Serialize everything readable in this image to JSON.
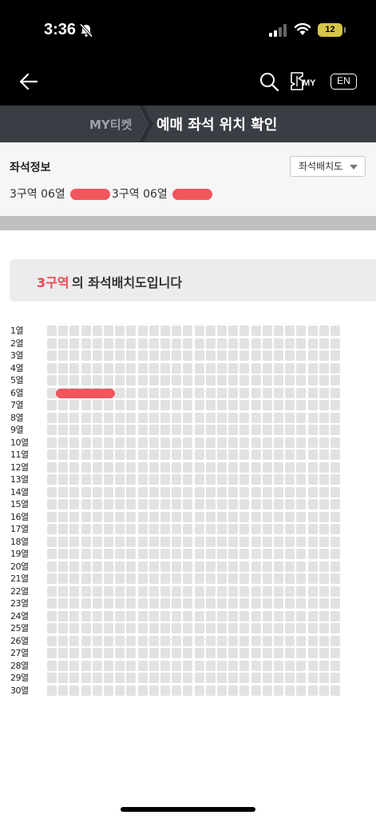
{
  "status_bar": {
    "time": "3:36",
    "battery": "12"
  },
  "header": {
    "lang_button": "EN",
    "my_label": "MY"
  },
  "breadcrumb": {
    "parent": "MY티켓",
    "title": "예매 좌석 위치 확인"
  },
  "seat_info": {
    "label": "좌석정보",
    "seatmap_button": "좌석배치도",
    "seats": [
      "3구역 06열",
      "3구역 06열"
    ]
  },
  "section_banner": {
    "zone": "3구역",
    "suffix": "의 좌석배치도입니다"
  },
  "seat_map": {
    "rows": [
      "1열",
      "2열",
      "3열",
      "4열",
      "5열",
      "6열",
      "7열",
      "8열",
      "9열",
      "10열",
      "11열",
      "12열",
      "13열",
      "14열",
      "15열",
      "16열",
      "17열",
      "18열",
      "19열",
      "20열",
      "21열",
      "22열",
      "23열",
      "24열",
      "25열",
      "26열",
      "27열",
      "28열",
      "29열",
      "30열"
    ],
    "columns": 26,
    "highlighted_row": 6,
    "colors": {
      "seat": "#e2e2e2",
      "highlight": "#f0565c",
      "zone": "#ea4a55"
    }
  }
}
